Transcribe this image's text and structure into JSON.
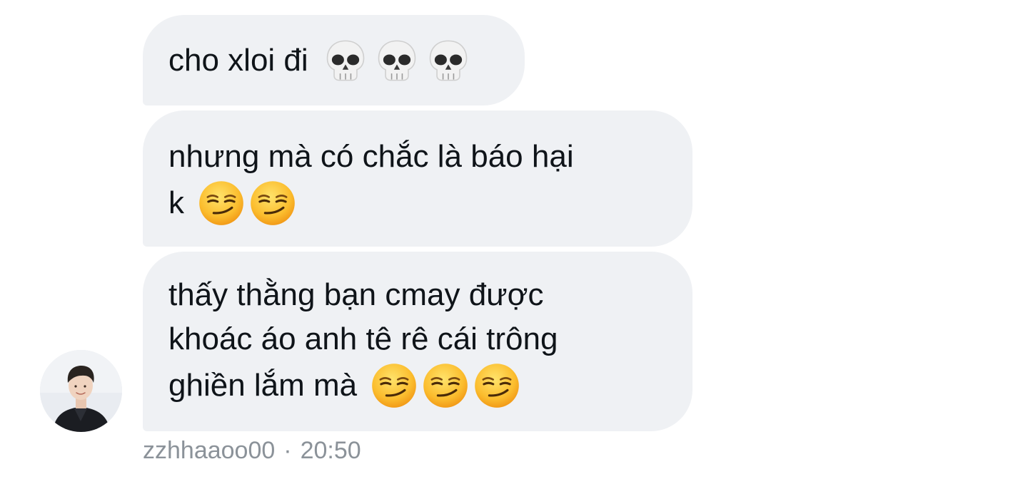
{
  "messages": [
    {
      "text": "cho xloi đi",
      "emojis": [
        "skull-icon",
        "skull-icon",
        "skull-icon"
      ]
    },
    {
      "lines": [
        "nhưng mà có chắc là báo hại",
        "k"
      ],
      "emojis": [
        "smirk-icon",
        "smirk-icon"
      ]
    },
    {
      "lines": [
        "thấy thằng bạn cmay được",
        "khoác áo anh tê rê cái trông",
        "ghiền lắm mà"
      ],
      "emojis": [
        "smirk-icon",
        "smirk-icon",
        "smirk-icon"
      ]
    }
  ],
  "meta": {
    "username": "zzhhaaoo00",
    "separator": "·",
    "time": "20:50"
  },
  "colors": {
    "bubble_bg": "#eff1f4",
    "text": "#0f1419",
    "meta_text": "#8b9299"
  }
}
